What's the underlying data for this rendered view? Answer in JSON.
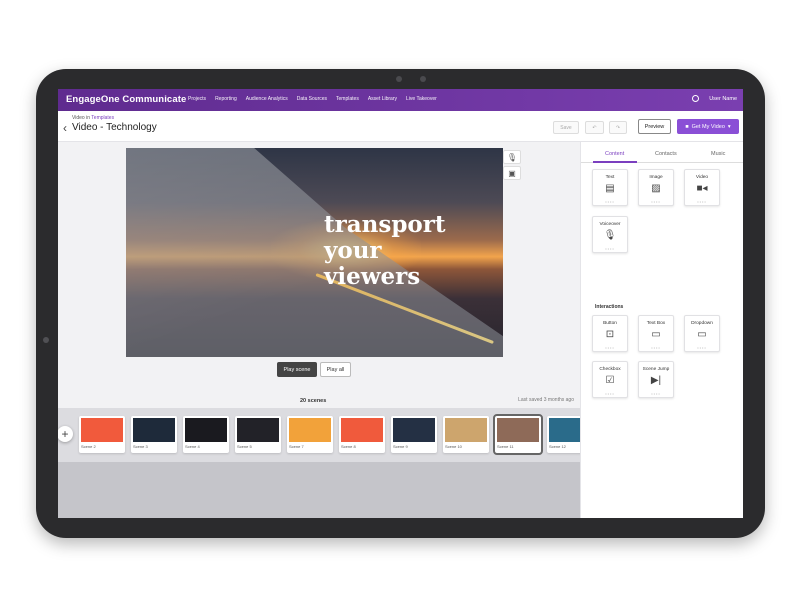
{
  "app": {
    "brand": "EngageOne Communicate",
    "nav": [
      "Projects",
      "Reporting",
      "Audience Analytics",
      "Data Sources",
      "Templates",
      "Asset Library",
      "Live Takeover"
    ],
    "user_name": "User Name"
  },
  "header": {
    "breadcrumb_prefix": "Video in",
    "breadcrumb_link": "Templates",
    "title": "Video - Technology",
    "save_label": "Save",
    "undo_icon": "undo-icon",
    "redo_icon": "redo-icon",
    "preview_label": "Preview",
    "get_video_label": "Get My Video"
  },
  "canvas": {
    "headline_lines": [
      "transport",
      "your",
      "viewers"
    ],
    "tools": [
      "mic-icon",
      "captions-icon"
    ]
  },
  "playback": {
    "play_scene_label": "Play scene",
    "play_all_label": "Play all"
  },
  "timeline": {
    "scene_count": "20 scenes",
    "last_saved": "Last saved 3 months ago",
    "add_label": "+",
    "scenes": [
      {
        "label": "Scene 2",
        "color": "#f15a3c"
      },
      {
        "label": "Scene 3",
        "color": "#1e2a3a"
      },
      {
        "label": "Scene 4",
        "color": "#1a1a1f"
      },
      {
        "label": "Scene 5",
        "color": "#222228"
      },
      {
        "label": "Scene 7",
        "color": "#f2a23a"
      },
      {
        "label": "Scene 8",
        "color": "#f05a3c"
      },
      {
        "label": "Scene 9",
        "color": "#243044"
      },
      {
        "label": "Scene 10",
        "color": "#cda56d"
      },
      {
        "label": "Scene 11",
        "color": "#8e6a58",
        "selected": true
      },
      {
        "label": "Scene 12",
        "color": "#2a6b8a"
      }
    ]
  },
  "panel": {
    "tabs": [
      "Content",
      "Contacts",
      "Music"
    ],
    "active_tab": "Content",
    "content_items": [
      {
        "label": "Text",
        "icon": "text-doc-icon",
        "glyph": "▤"
      },
      {
        "label": "Image",
        "icon": "image-icon",
        "glyph": "▨"
      },
      {
        "label": "Video",
        "icon": "video-camera-icon",
        "glyph": "■◂"
      },
      {
        "label": "Voiceover",
        "icon": "microphone-icon",
        "glyph": "🎙"
      }
    ],
    "interactions_label": "Interactions",
    "interaction_items": [
      {
        "label": "Button",
        "icon": "button-click-icon",
        "glyph": "⊡"
      },
      {
        "label": "Text Box",
        "icon": "text-box-icon",
        "glyph": "▭"
      },
      {
        "label": "Dropdown",
        "icon": "dropdown-icon",
        "glyph": "▭"
      },
      {
        "label": "Checkbox",
        "icon": "checkbox-icon",
        "glyph": "☑"
      },
      {
        "label": "Scene Jump",
        "icon": "scene-jump-icon",
        "glyph": "▶|"
      }
    ],
    "tile_placeholder": "••••"
  },
  "colors": {
    "nav_bg": "#6a339e",
    "accent": "#8a4fd6",
    "device_frame": "#2b2b2d"
  }
}
